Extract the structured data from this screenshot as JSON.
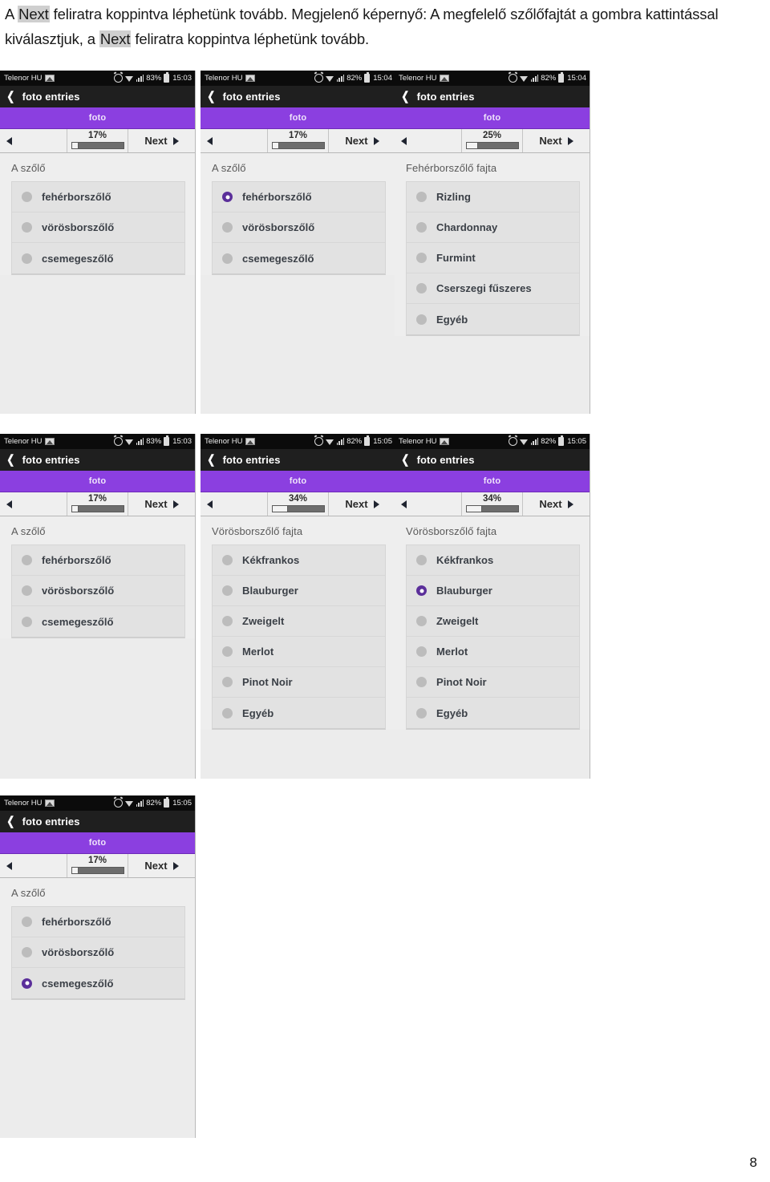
{
  "caption": {
    "segments": [
      {
        "text": "A ",
        "highlight": false
      },
      {
        "text": "Next",
        "highlight": true
      },
      {
        "text": " feliratra koppintva léphetünk tovább. Megjelenő képernyő: A megfelelő szőlőfajtát a gombra kattintással kiválasztjuk, a ",
        "highlight": false
      },
      {
        "text": "Next",
        "highlight": true
      },
      {
        "text": " feliratra koppintva léphetünk tovább.",
        "highlight": false
      }
    ],
    "full_text": "A Next feliratra koppintva léphetünk tovább. Megjelenő képernyő: A megfelelő szőlőfajtát a gombra kattintással kiválasztjuk, a Next feliratra koppintva léphetünk tovább."
  },
  "page_number": "8",
  "colors": {
    "tab_purple": "#8b3fe0",
    "radio_selected": "#5b2f9a",
    "statusbar_bg": "#0b0b0b",
    "actionbar_bg": "#1f1f1f",
    "screen_bg": "#eeeeee",
    "list_bg": "#e2e2e2"
  },
  "common": {
    "carrier": "Telenor HU",
    "app_title": "foto entries",
    "tab_label": "foto",
    "next_label": "Next",
    "back_icon": "chevron-left-icon",
    "prev_icon": "triangle-left-icon",
    "next_icon": "triangle-right-icon",
    "status_icons": [
      "alarm-icon",
      "wifi-icon",
      "signal-icon",
      "battery-icon",
      "screenshot-icon"
    ]
  },
  "screenshots": [
    {
      "id": "s1",
      "row": 1,
      "col": 1,
      "status": {
        "battery": "83%",
        "time": "15:03"
      },
      "progress": {
        "percent": "17%",
        "fill": 14
      },
      "group_title": "A szőlő",
      "options": [
        {
          "label": "fehérborszőlő",
          "selected": false
        },
        {
          "label": "vörösborszőlő",
          "selected": false
        },
        {
          "label": "csemegeszőlő",
          "selected": false
        }
      ]
    },
    {
      "id": "s2",
      "row": 1,
      "col": 2,
      "status": {
        "battery": "82%",
        "time": "15:04"
      },
      "progress": {
        "percent": "17%",
        "fill": 14
      },
      "group_title": "A szőlő",
      "options": [
        {
          "label": "fehérborszőlő",
          "selected": true
        },
        {
          "label": "vörösborszőlő",
          "selected": false
        },
        {
          "label": "csemegeszőlő",
          "selected": false
        }
      ]
    },
    {
      "id": "s3",
      "row": 1,
      "col": 3,
      "status": {
        "battery": "82%",
        "time": "15:04"
      },
      "progress": {
        "percent": "25%",
        "fill": 22
      },
      "group_title": "Fehérborszőlő fajta",
      "options": [
        {
          "label": "Rizling",
          "selected": false
        },
        {
          "label": "Chardonnay",
          "selected": false
        },
        {
          "label": "Furmint",
          "selected": false
        },
        {
          "label": "Cserszegi fűszeres",
          "selected": false
        },
        {
          "label": "Egyéb",
          "selected": false
        }
      ]
    },
    {
      "id": "s4",
      "row": 2,
      "col": 1,
      "status": {
        "battery": "83%",
        "time": "15:03"
      },
      "progress": {
        "percent": "17%",
        "fill": 14
      },
      "group_title": "A szőlő",
      "options": [
        {
          "label": "fehérborszőlő",
          "selected": false
        },
        {
          "label": "vörösborszőlő",
          "selected": false
        },
        {
          "label": "csemegeszőlő",
          "selected": false
        }
      ]
    },
    {
      "id": "s5",
      "row": 2,
      "col": 2,
      "status": {
        "battery": "82%",
        "time": "15:05"
      },
      "progress": {
        "percent": "34%",
        "fill": 30
      },
      "group_title": "Vörösborszőlő fajta",
      "options": [
        {
          "label": "Kékfrankos",
          "selected": false
        },
        {
          "label": "Blauburger",
          "selected": false
        },
        {
          "label": "Zweigelt",
          "selected": false
        },
        {
          "label": "Merlot",
          "selected": false
        },
        {
          "label": "Pinot Noir",
          "selected": false
        },
        {
          "label": "Egyéb",
          "selected": false
        }
      ]
    },
    {
      "id": "s6",
      "row": 2,
      "col": 3,
      "status": {
        "battery": "82%",
        "time": "15:05"
      },
      "progress": {
        "percent": "34%",
        "fill": 30
      },
      "group_title": "Vörösborszőlő fajta",
      "options": [
        {
          "label": "Kékfrankos",
          "selected": false
        },
        {
          "label": "Blauburger",
          "selected": true
        },
        {
          "label": "Zweigelt",
          "selected": false
        },
        {
          "label": "Merlot",
          "selected": false
        },
        {
          "label": "Pinot Noir",
          "selected": false
        },
        {
          "label": "Egyéb",
          "selected": false
        }
      ]
    },
    {
      "id": "s7",
      "row": 3,
      "col": 1,
      "status": {
        "battery": "82%",
        "time": "15:05"
      },
      "progress": {
        "percent": "17%",
        "fill": 14
      },
      "group_title": "A szőlő",
      "options": [
        {
          "label": "fehérborszőlő",
          "selected": false
        },
        {
          "label": "vörösborszőlő",
          "selected": false
        },
        {
          "label": "csemegeszőlő",
          "selected": true
        }
      ]
    }
  ]
}
